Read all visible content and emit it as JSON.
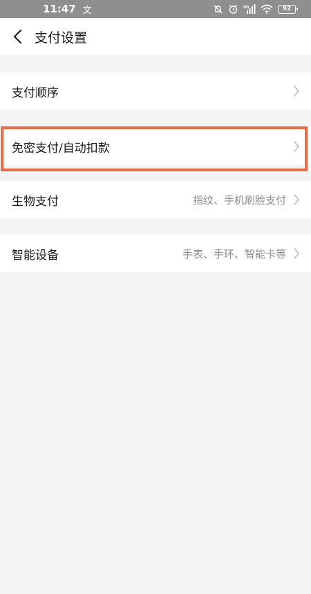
{
  "status_bar": {
    "time": "11:47",
    "left_icon": "文",
    "battery": "92"
  },
  "nav": {
    "title": "支付设置"
  },
  "rows": [
    {
      "label": "支付顺序",
      "value": ""
    },
    {
      "label": "免密支付/自动扣款",
      "value": ""
    },
    {
      "label": "生物支付",
      "value": "指纹、手机刷脸支付"
    },
    {
      "label": "智能设备",
      "value": "手表、手环、智能卡等"
    }
  ],
  "colors": {
    "highlight": "#ee6a43",
    "background": "#f4f4f4",
    "status_bar": "#8f8f8f"
  },
  "icons": [
    "back-arrow-icon",
    "chevron-right-icon",
    "mute-icon",
    "alarm-icon",
    "signal-icon",
    "wifi-icon",
    "battery-icon"
  ]
}
